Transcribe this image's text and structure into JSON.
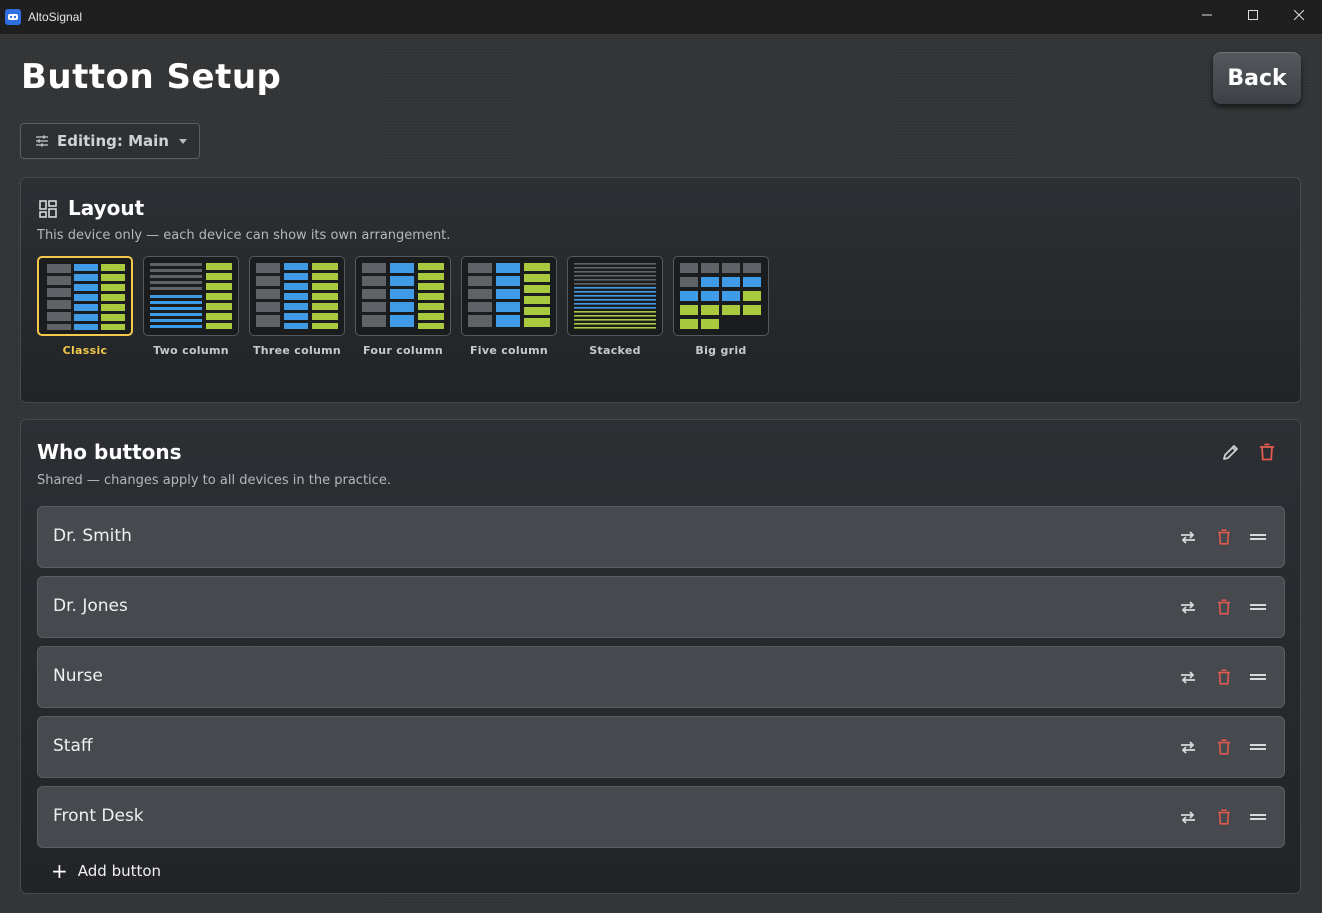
{
  "window": {
    "title": "AltoSignal"
  },
  "page": {
    "title": "Button Setup",
    "back_label": "Back"
  },
  "editing_dropdown": {
    "label": "Editing: Main"
  },
  "layout": {
    "title": "Layout",
    "subtitle": "This device only — each device can show its own arrangement.",
    "options": [
      {
        "name": "Classic",
        "selected": true
      },
      {
        "name": "Two column",
        "selected": false
      },
      {
        "name": "Three column",
        "selected": false
      },
      {
        "name": "Four column",
        "selected": false
      },
      {
        "name": "Five column",
        "selected": false
      },
      {
        "name": "Stacked",
        "selected": false
      },
      {
        "name": "Big grid",
        "selected": false
      }
    ]
  },
  "who": {
    "title": "Who buttons",
    "subtitle": "Shared — changes apply to all devices in the practice.",
    "rows": [
      {
        "label": "Dr. Smith"
      },
      {
        "label": "Dr. Jones"
      },
      {
        "label": "Nurse"
      },
      {
        "label": "Staff"
      },
      {
        "label": "Front Desk"
      }
    ],
    "add_label": "Add button"
  },
  "colors": {
    "accent_selected": "#f2c94c",
    "delete": "#e05a4f",
    "preview_gray": "#5f6266",
    "preview_blue": "#3f9be6",
    "preview_green": "#a9c93e"
  }
}
